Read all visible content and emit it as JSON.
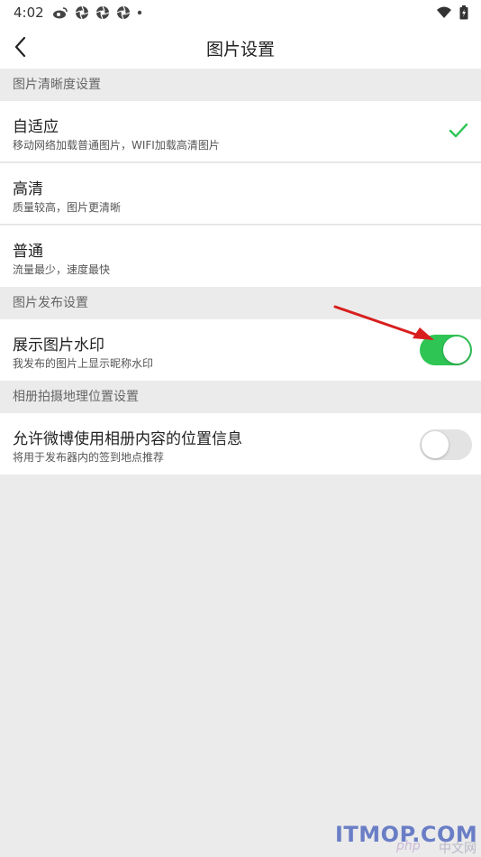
{
  "status_bar": {
    "time": "4:02"
  },
  "header": {
    "title": "图片设置"
  },
  "sections": [
    {
      "header": "图片清晰度设置"
    },
    {
      "header": "图片发布设置"
    },
    {
      "header": "相册拍摄地理位置设置"
    }
  ],
  "quality_options": [
    {
      "title": "自适应",
      "subtitle": "移动网络加载普通图片，WIFI加载高清图片",
      "selected": true
    },
    {
      "title": "高清",
      "subtitle": "质量较高，图片更清晰",
      "selected": false
    },
    {
      "title": "普通",
      "subtitle": "流量最少，速度最快",
      "selected": false
    }
  ],
  "watermark": {
    "title": "展示图片水印",
    "subtitle": "我发布的图片上显示昵称水印",
    "enabled": true
  },
  "location": {
    "title": "允许微博使用相册内容的位置信息",
    "subtitle": "将用于发布器内的签到地点推荐",
    "enabled": false
  },
  "watermark_text": {
    "php": "php",
    "cn": "中文网",
    "site": "ITMOP.COM"
  },
  "colors": {
    "accent": "#2fc555",
    "arrow": "#d81e1e",
    "background": "#ebebeb"
  }
}
